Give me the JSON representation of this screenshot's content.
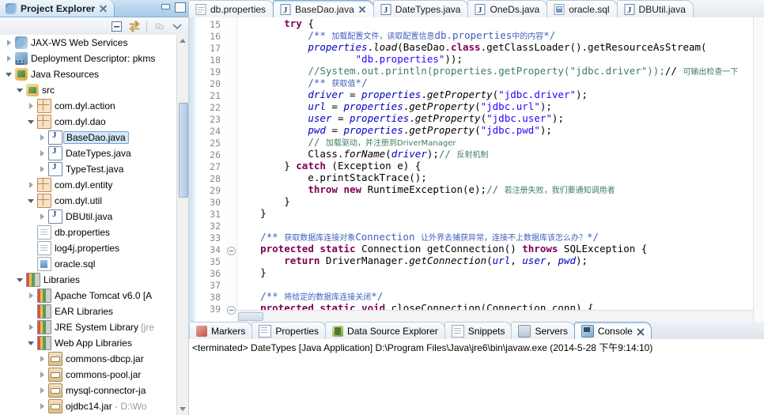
{
  "explorer": {
    "title": "Project Explorer",
    "toolbar": [
      {
        "name": "collapse-all-icon"
      },
      {
        "name": "link-with-editor-icon"
      },
      {
        "name": "focus-on-active-task-icon"
      },
      {
        "name": "view-menu-icon"
      }
    ],
    "tree": [
      {
        "label": "JAX-WS Web Services",
        "icon": "web-service-icon",
        "indent": 0,
        "arrow": "collapsed",
        "selected": false
      },
      {
        "label": "Deployment Descriptor: pkms",
        "icon": "deployment-descriptor-icon",
        "indent": 0,
        "arrow": "collapsed",
        "selected": false
      },
      {
        "label": "Java Resources",
        "icon": "java-resources-icon",
        "indent": 0,
        "arrow": "expanded",
        "selected": false
      },
      {
        "label": "src",
        "icon": "source-folder-icon",
        "indent": 1,
        "arrow": "expanded",
        "selected": false
      },
      {
        "label": "com.dyl.action",
        "icon": "package-icon",
        "indent": 2,
        "arrow": "collapsed",
        "selected": false
      },
      {
        "label": "com.dyl.dao",
        "icon": "package-icon",
        "indent": 2,
        "arrow": "expanded",
        "selected": false
      },
      {
        "label": "BaseDao.java",
        "icon": "java-file-icon",
        "indent": 3,
        "arrow": "collapsed",
        "selected": true
      },
      {
        "label": "DateTypes.java",
        "icon": "java-file-icon",
        "indent": 3,
        "arrow": "collapsed",
        "selected": false
      },
      {
        "label": "TypeTest.java",
        "icon": "java-file-icon",
        "indent": 3,
        "arrow": "collapsed",
        "selected": false
      },
      {
        "label": "com.dyl.entity",
        "icon": "package-icon",
        "indent": 2,
        "arrow": "collapsed",
        "selected": false
      },
      {
        "label": "com.dyl.util",
        "icon": "package-icon",
        "indent": 2,
        "arrow": "expanded",
        "selected": false
      },
      {
        "label": "DBUtil.java",
        "icon": "java-file-icon",
        "indent": 3,
        "arrow": "collapsed",
        "selected": false
      },
      {
        "label": "db.properties",
        "icon": "properties-file-icon",
        "indent": 2,
        "arrow": "none",
        "selected": false
      },
      {
        "label": "log4j.properties",
        "icon": "properties-file-icon",
        "indent": 2,
        "arrow": "none",
        "selected": false
      },
      {
        "label": "oracle.sql",
        "icon": "sql-file-icon",
        "indent": 2,
        "arrow": "none",
        "selected": false
      },
      {
        "label": "Libraries",
        "icon": "library-icon",
        "indent": 1,
        "arrow": "expanded",
        "selected": false
      },
      {
        "label": "Apache Tomcat v6.0 [A",
        "icon": "library-icon",
        "indent": 2,
        "arrow": "collapsed",
        "selected": false
      },
      {
        "label": "EAR Libraries",
        "icon": "library-icon",
        "indent": 2,
        "arrow": "none",
        "selected": false
      },
      {
        "label": "JRE System Library ",
        "dim": "[jre",
        "icon": "library-icon",
        "indent": 2,
        "arrow": "collapsed",
        "selected": false
      },
      {
        "label": "Web App Libraries",
        "icon": "library-icon",
        "indent": 2,
        "arrow": "expanded",
        "selected": false
      },
      {
        "label": "commons-dbcp.jar",
        "icon": "jar-icon",
        "indent": 3,
        "arrow": "collapsed",
        "selected": false
      },
      {
        "label": "commons-pool.jar",
        "icon": "jar-icon",
        "indent": 3,
        "arrow": "collapsed",
        "selected": false
      },
      {
        "label": "mysql-connector-ja",
        "icon": "jar-icon",
        "indent": 3,
        "arrow": "collapsed",
        "selected": false
      },
      {
        "label": "ojdbc14.jar ",
        "dim": "- D:\\Wo",
        "icon": "jar-icon",
        "indent": 3,
        "arrow": "collapsed",
        "selected": false
      }
    ]
  },
  "editor": {
    "tabs": [
      {
        "label": "db.properties",
        "icon": "properties-file-icon",
        "active": false,
        "closable": false
      },
      {
        "label": "BaseDao.java",
        "icon": "java-file-icon",
        "active": true,
        "closable": true
      },
      {
        "label": "DateTypes.java",
        "icon": "java-file-icon",
        "active": false,
        "closable": false
      },
      {
        "label": "OneDs.java",
        "icon": "java-file-icon",
        "active": false,
        "closable": false
      },
      {
        "label": "oracle.sql",
        "icon": "sql-file-icon",
        "active": false,
        "closable": false
      },
      {
        "label": "DBUtil.java",
        "icon": "java-file-icon",
        "active": false,
        "closable": false
      }
    ],
    "first_line_number": 15,
    "fold_markers": [
      34,
      39
    ],
    "code_lines": [
      {
        "n": 15,
        "html": "        <span class=\"kw\">try</span> {"
      },
      {
        "n": 16,
        "html": "            <span class=\"jdoc\">/** <span class=\"cn\">加载配置文件，读取配置信息</span>db.properties<span class=\"cn\">中的内容</span>*/</span>"
      },
      {
        "n": 17,
        "html": "            <span class=\"fld\">properties</span>.<span class=\"mth\">load</span>(BaseDao.<span class=\"kw\">class</span>.getClassLoader().getResourceAsStream("
      },
      {
        "n": 18,
        "html": "                    <span class=\"str\">\"db.properties\"</span>));"
      },
      {
        "n": 19,
        "html": "            <span class=\"cmt\">//System.out.println(properties.getProperty(\"jdbc.driver\"));</span>// <span class=\"cmt cn\">可输出检查一下</span>"
      },
      {
        "n": 20,
        "html": "            <span class=\"jdoc\">/** <span class=\"cn\">获取值</span>*/</span>"
      },
      {
        "n": 21,
        "html": "            <span class=\"fld\">driver</span> = <span class=\"fld\">properties</span>.<span class=\"mth\">getProperty</span>(<span class=\"str\">\"jdbc.driver\"</span>);"
      },
      {
        "n": 22,
        "html": "            <span class=\"fld\">url</span> = <span class=\"fld\">properties</span>.<span class=\"mth\">getProperty</span>(<span class=\"str\">\"jdbc.url\"</span>);"
      },
      {
        "n": 23,
        "html": "            <span class=\"fld\">user</span> = <span class=\"fld\">properties</span>.<span class=\"mth\">getProperty</span>(<span class=\"str\">\"jdbc.user\"</span>);"
      },
      {
        "n": 24,
        "html": "            <span class=\"fld\">pwd</span> = <span class=\"fld\">properties</span>.<span class=\"mth\">getProperty</span>(<span class=\"str\">\"jdbc.pwd\"</span>);"
      },
      {
        "n": 25,
        "html": "            <span class=\"cmt\">// <span class=\"cn\">加载驱动，并注册到DriverManager</span></span>"
      },
      {
        "n": 26,
        "html": "            Class.<span class=\"mth\">forName</span>(<span class=\"fld\">driver</span>);<span class=\"cmt\">// <span class=\"cn\">反射机制</span></span>"
      },
      {
        "n": 27,
        "html": "        } <span class=\"kw\">catch</span> (Exception e) {"
      },
      {
        "n": 28,
        "html": "            e.printStackTrace();"
      },
      {
        "n": 29,
        "html": "            <span class=\"kw\">throw new</span> RuntimeException(e);<span class=\"cmt\">// <span class=\"cn\">若注册失败，我们要通知调用者</span></span>"
      },
      {
        "n": 30,
        "html": "        }"
      },
      {
        "n": 31,
        "html": "    }"
      },
      {
        "n": 32,
        "html": ""
      },
      {
        "n": 33,
        "html": "    <span class=\"jdoc\">/** <span class=\"cn\">获取数据库连接对象</span>Connection <span class=\"cn\">让外界去捕获异常，连接不上数据库该怎么办？</span>*/</span>"
      },
      {
        "n": 34,
        "html": "    <span class=\"kw\">protected static</span> Connection getConnection() <span class=\"kw\">throws</span> SQLException {"
      },
      {
        "n": 35,
        "html": "        <span class=\"kw\">return</span> DriverManager.<span class=\"mth\">getConnection</span>(<span class=\"fld\">url</span>, <span class=\"fld\">user</span>, <span class=\"fld\">pwd</span>);"
      },
      {
        "n": 36,
        "html": "    }"
      },
      {
        "n": 37,
        "html": ""
      },
      {
        "n": 38,
        "html": "    <span class=\"jdoc\">/** <span class=\"cn\">将给定的数据库连接关闭</span>*/</span>"
      },
      {
        "n": 39,
        "html": "    <span class=\"kw\">protected static void</span> closeConnection(Connection conn) {"
      }
    ]
  },
  "bottom_panel": {
    "tabs": [
      {
        "label": "Markers",
        "icon": "markers-icon",
        "active": false,
        "closable": false
      },
      {
        "label": "Properties",
        "icon": "properties-view-icon",
        "active": false,
        "closable": false
      },
      {
        "label": "Data Source Explorer",
        "icon": "data-source-explorer-icon",
        "active": false,
        "closable": false
      },
      {
        "label": "Snippets",
        "icon": "snippets-icon",
        "active": false,
        "closable": false
      },
      {
        "label": "Servers",
        "icon": "servers-icon",
        "active": false,
        "closable": false
      },
      {
        "label": "Console",
        "icon": "console-icon",
        "active": true,
        "closable": true
      }
    ],
    "console_text": "<terminated> DateTypes [Java Application] D:\\Program Files\\Java\\jre6\\bin\\javaw.exe (2014-5-28 下午9:14:10)"
  }
}
